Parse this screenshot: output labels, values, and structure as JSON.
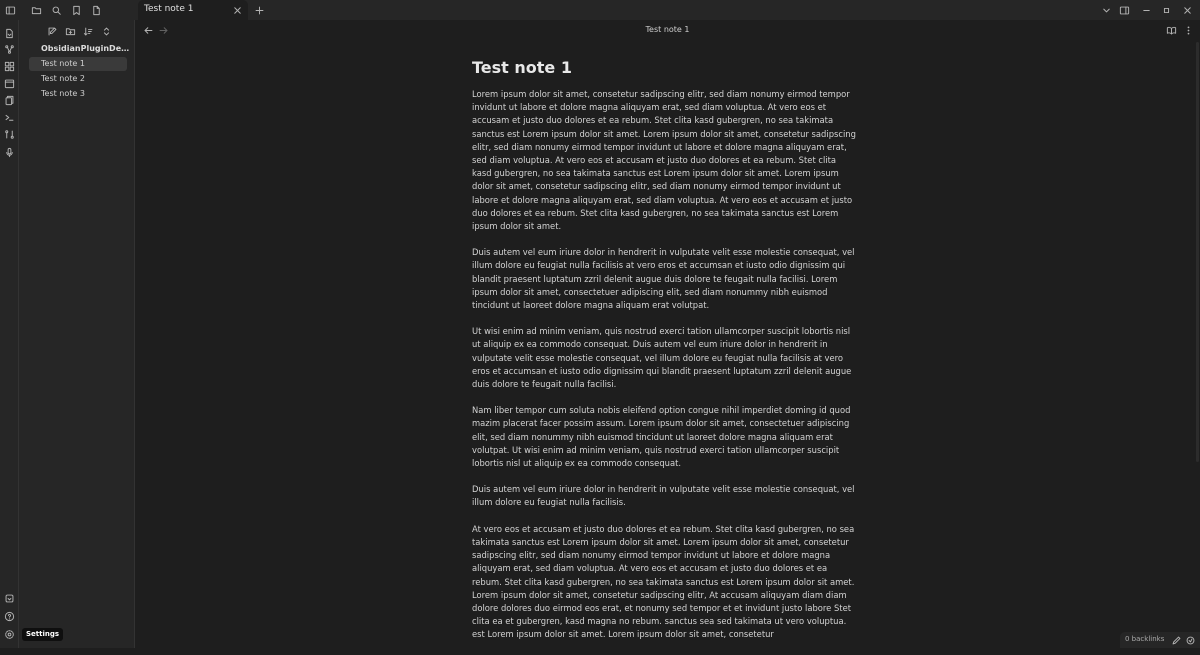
{
  "tab": {
    "title": "Test note 1"
  },
  "sidebar": {
    "vault_name": "ObsidianPluginDevelo...",
    "files": [
      {
        "label": "Test note 1"
      },
      {
        "label": "Test note 2"
      },
      {
        "label": "Test note 3"
      }
    ]
  },
  "view": {
    "header_title": "Test note 1"
  },
  "note": {
    "title": "Test note 1",
    "paragraphs": [
      "Lorem ipsum dolor sit amet, consetetur sadipscing elitr, sed diam nonumy eirmod tempor invidunt ut labore et dolore magna aliquyam erat, sed diam voluptua. At vero eos et accusam et justo duo dolores et ea rebum. Stet clita kasd gubergren, no sea takimata sanctus est Lorem ipsum dolor sit amet. Lorem ipsum dolor sit amet, consetetur sadipscing elitr, sed diam nonumy eirmod tempor invidunt ut labore et dolore magna aliquyam erat, sed diam voluptua. At vero eos et accusam et justo duo dolores et ea rebum. Stet clita kasd gubergren, no sea takimata sanctus est Lorem ipsum dolor sit amet. Lorem ipsum dolor sit amet, consetetur sadipscing elitr, sed diam nonumy eirmod tempor invidunt ut labore et dolore magna aliquyam erat, sed diam voluptua. At vero eos et accusam et justo duo dolores et ea rebum. Stet clita kasd gubergren, no sea takimata sanctus est Lorem ipsum dolor sit amet.",
      "Duis autem vel eum iriure dolor in hendrerit in vulputate velit esse molestie consequat, vel illum dolore eu feugiat nulla facilisis at vero eros et accumsan et iusto odio dignissim qui blandit praesent luptatum zzril delenit augue duis dolore te feugait nulla facilisi. Lorem ipsum dolor sit amet, consectetuer adipiscing elit, sed diam nonummy nibh euismod tincidunt ut laoreet dolore magna aliquam erat volutpat.",
      "Ut wisi enim ad minim veniam, quis nostrud exerci tation ullamcorper suscipit lobortis nisl ut aliquip ex ea commodo consequat. Duis autem vel eum iriure dolor in hendrerit in vulputate velit esse molestie consequat, vel illum dolore eu feugiat nulla facilisis at vero eros et accumsan et iusto odio dignissim qui blandit praesent luptatum zzril delenit augue duis dolore te feugait nulla facilisi.",
      "Nam liber tempor cum soluta nobis eleifend option congue nihil imperdiet doming id quod mazim placerat facer possim assum. Lorem ipsum dolor sit amet, consectetuer adipiscing elit, sed diam nonummy nibh euismod tincidunt ut laoreet dolore magna aliquam erat volutpat. Ut wisi enim ad minim veniam, quis nostrud exerci tation ullamcorper suscipit lobortis nisl ut aliquip ex ea commodo consequat.",
      "Duis autem vel eum iriure dolor in hendrerit in vulputate velit esse molestie consequat, vel illum dolore eu feugiat nulla facilisis.",
      "At vero eos et accusam et justo duo dolores et ea rebum. Stet clita kasd gubergren, no sea takimata sanctus est Lorem ipsum dolor sit amet. Lorem ipsum dolor sit amet, consetetur sadipscing elitr, sed diam nonumy eirmod tempor invidunt ut labore et dolore magna aliquyam erat, sed diam voluptua. At vero eos et accusam et justo duo dolores et ea rebum. Stet clita kasd gubergren, no sea takimata sanctus est Lorem ipsum dolor sit amet. Lorem ipsum dolor sit amet, consetetur sadipscing elitr, At accusam aliquyam diam diam dolore dolores duo eirmod eos erat, et nonumy sed tempor et et invidunt justo labore Stet clita ea et gubergren, kasd magna no rebum. sanctus sea sed takimata ut vero voluptua. est Lorem ipsum dolor sit amet. Lorem ipsum dolor sit amet, consetetur"
    ]
  },
  "status": {
    "backlinks": "0 backlinks"
  },
  "tooltip": {
    "text": "Settings"
  }
}
